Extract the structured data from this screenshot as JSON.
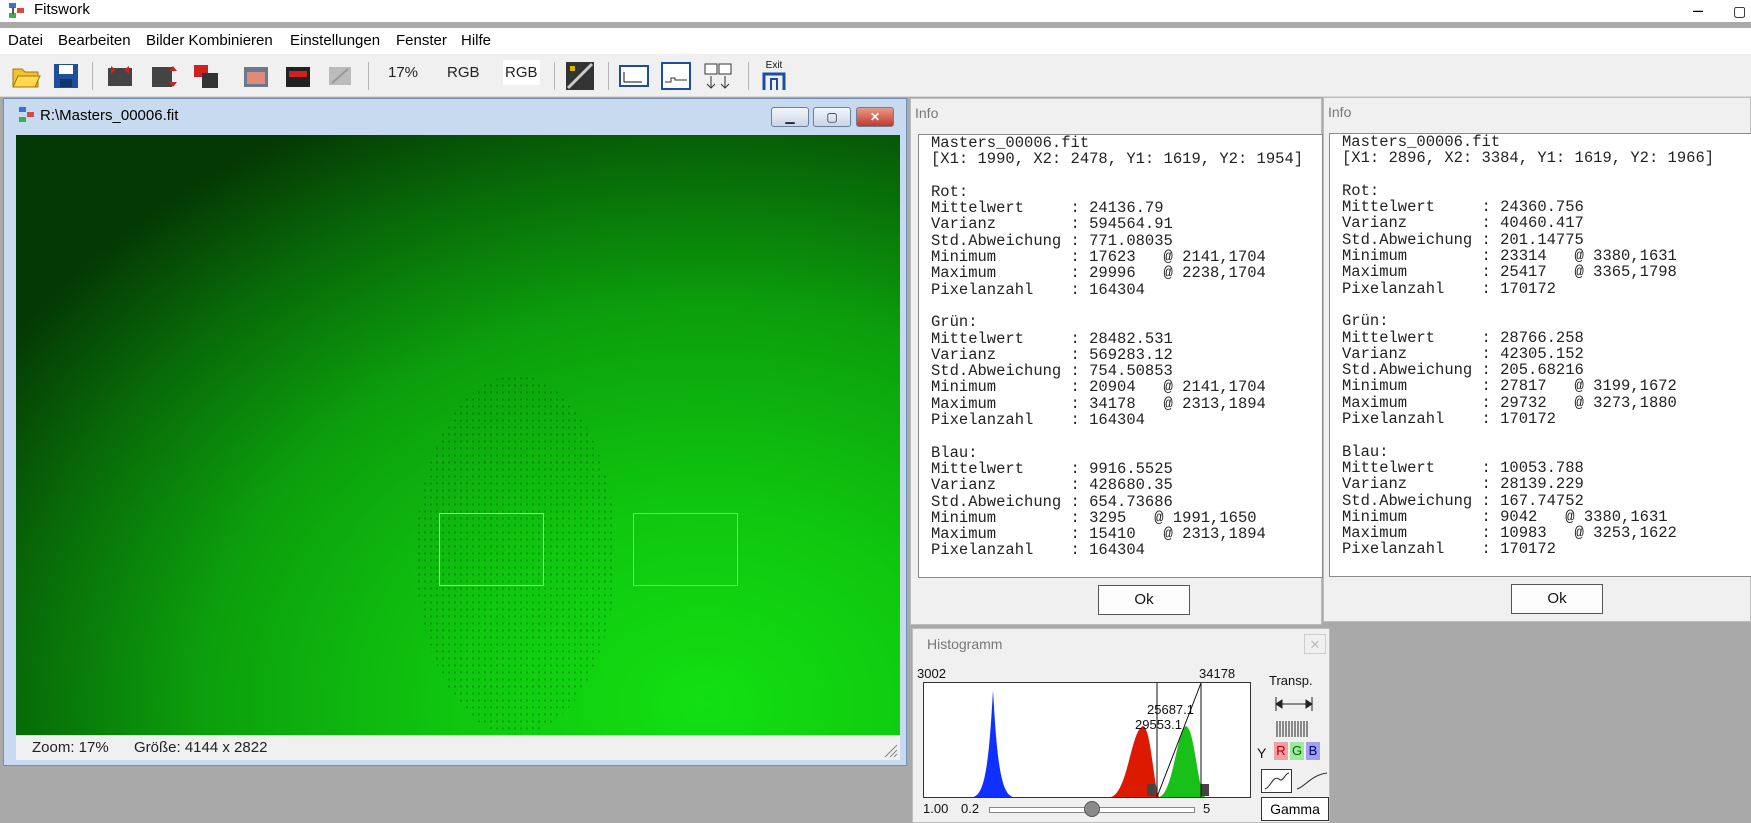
{
  "app": {
    "title": "Fitswork"
  },
  "menu": [
    "Datei",
    "Bearbeiten",
    "Bilder Kombinieren",
    "Einstellungen",
    "Fenster",
    "Hilfe"
  ],
  "toolbar": {
    "zoom": "17%",
    "rgb1": "RGB",
    "rgb2": "RGB",
    "exit": "Exit"
  },
  "image_window": {
    "title": "R:\\Masters_00006.fit",
    "zoom_label": "Zoom: 17%",
    "size_label": "Größe: 4144 x 2822"
  },
  "info1": {
    "title": "Info",
    "text": "Masters_00006.fit\n[X1: 1990, X2: 2478, Y1: 1619, Y2: 1954]\n\nRot:\nMittelwert     : 24136.79\nVarianz        : 594564.91\nStd.Abweichung : 771.08035\nMinimum        : 17623   @ 2141,1704\nMaximum        : 29996   @ 2238,1704\nPixelanzahl    : 164304\n\nGrün:\nMittelwert     : 28482.531\nVarianz        : 569283.12\nStd.Abweichung : 754.50853\nMinimum        : 20904   @ 2141,1704\nMaximum        : 34178   @ 2313,1894\nPixelanzahl    : 164304\n\nBlau:\nMittelwert     : 9916.5525\nVarianz        : 428680.35\nStd.Abweichung : 654.73686\nMinimum        : 3295   @ 1991,1650\nMaximum        : 15410   @ 2313,1894\nPixelanzahl    : 164304",
    "ok": "Ok"
  },
  "info2": {
    "title": "Info",
    "text": "Masters_00006.fit\n[X1: 2896, X2: 3384, Y1: 1619, Y2: 1966]\n\nRot:\nMittelwert     : 24360.756\nVarianz        : 40460.417\nStd.Abweichung : 201.14775\nMinimum        : 23314   @ 3380,1631\nMaximum        : 25417   @ 3365,1798\nPixelanzahl    : 170172\n\nGrün:\nMittelwert     : 28766.258\nVarianz        : 42305.152\nStd.Abweichung : 205.68216\nMinimum        : 27817   @ 3199,1672\nMaximum        : 29732   @ 3273,1880\nPixelanzahl    : 170172\n\nBlau:\nMittelwert     : 10053.788\nVarianz        : 28139.229\nStd.Abweichung : 167.74752\nMinimum        : 9042   @ 3380,1631\nMaximum        : 10983   @ 3253,1622\nPixelanzahl    : 170172",
    "ok": "Ok"
  },
  "histogram": {
    "title": "Histogramm",
    "min_label": "3002",
    "max_label": "34178",
    "marker1": "25687.1",
    "marker2": "29553.1",
    "transp": "Transp.",
    "channel_y": "Y",
    "channel_r": "R",
    "channel_g": "G",
    "channel_b": "B",
    "gamma_value": "1.00",
    "slider_min": "0.2",
    "slider_max": "5",
    "slider_value": 1.0,
    "gamma_button": "Gamma",
    "colors": {
      "blue": "#1030ff",
      "red": "#dd1a00",
      "green": "#18c018"
    }
  }
}
